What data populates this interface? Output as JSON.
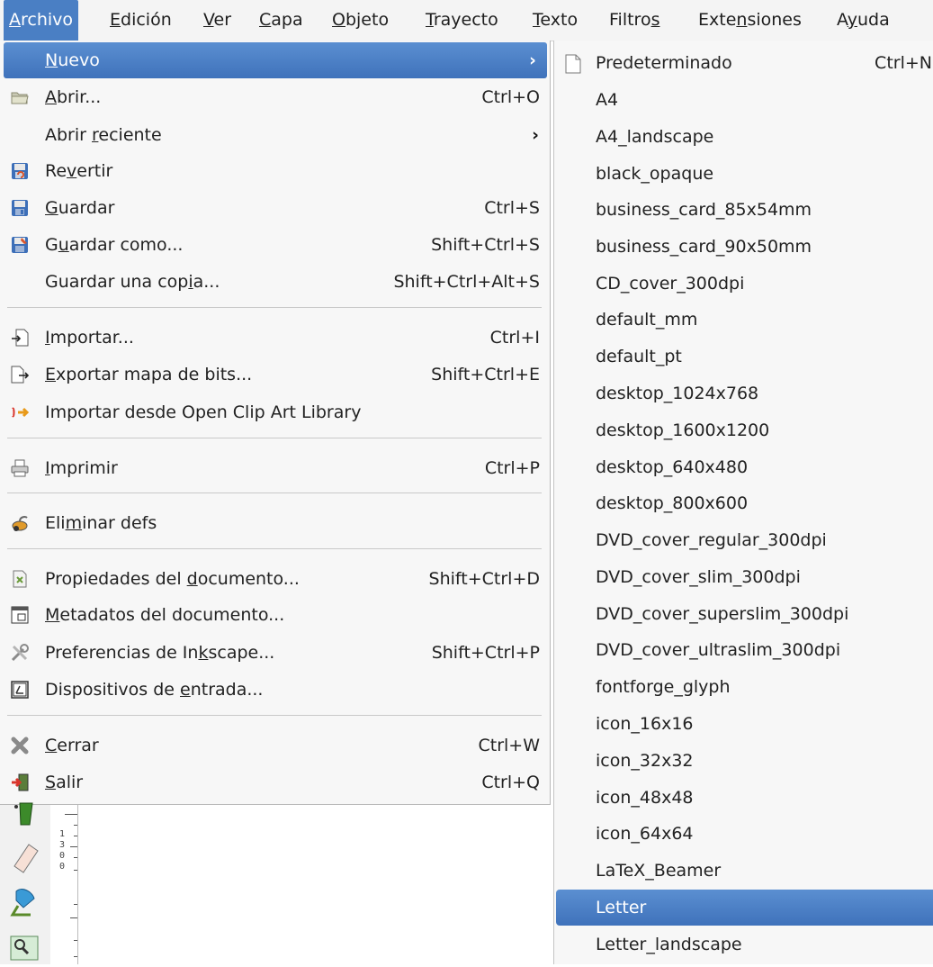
{
  "menubar": {
    "items": [
      {
        "pre": "",
        "u": "A",
        "post": "rchivo",
        "active": true
      },
      {
        "pre": "",
        "u": "E",
        "post": "dición"
      },
      {
        "pre": "",
        "u": "V",
        "post": "er"
      },
      {
        "pre": "",
        "u": "C",
        "post": "apa"
      },
      {
        "pre": "",
        "u": "O",
        "post": "bjeto"
      },
      {
        "pre": "",
        "u": "T",
        "post": "rayecto"
      },
      {
        "pre": "",
        "u": "T",
        "post": "exto"
      },
      {
        "pre": "Filtro",
        "u": "s",
        "post": ""
      },
      {
        "pre": "Exte",
        "u": "n",
        "post": "siones"
      },
      {
        "pre": "A",
        "u": "y",
        "post": "uda"
      }
    ]
  },
  "archivo_menu": {
    "nuevo": {
      "pre": "",
      "u": "N",
      "post": "uevo",
      "arrow": "›"
    },
    "abrir": {
      "pre": "",
      "u": "A",
      "post": "brir...",
      "shortcut": "Ctrl+O",
      "icon": "folder-open-icon"
    },
    "abrir_reciente": {
      "pre": "Abrir ",
      "u": "r",
      "post": "eciente",
      "arrow": "›"
    },
    "revertir": {
      "pre": "Re",
      "u": "v",
      "post": "ertir",
      "icon": "revert-icon"
    },
    "guardar": {
      "pre": "",
      "u": "G",
      "post": "uardar",
      "shortcut": "Ctrl+S",
      "icon": "save-icon"
    },
    "guardar_como": {
      "pre": "G",
      "u": "u",
      "post": "ardar como...",
      "shortcut": "Shift+Ctrl+S",
      "icon": "save-as-icon"
    },
    "guardar_copia": {
      "pre": "Guardar una cop",
      "u": "i",
      "post": "a...",
      "shortcut": "Shift+Ctrl+Alt+S"
    },
    "importar": {
      "pre": "",
      "u": "I",
      "post": "mportar...",
      "shortcut": "Ctrl+I",
      "icon": "import-icon"
    },
    "exportar": {
      "pre": "",
      "u": "E",
      "post": "xportar mapa de bits...",
      "shortcut": "Shift+Ctrl+E",
      "icon": "export-icon"
    },
    "importar_ocal": {
      "pre": "Importar desde Open Clip Art Library",
      "u": "",
      "post": "",
      "icon": "open-clip-art-icon"
    },
    "imprimir": {
      "pre": "",
      "u": "I",
      "post": "mprimir",
      "shortcut": "Ctrl+P",
      "icon": "print-icon"
    },
    "eliminar_defs": {
      "pre": "Eli",
      "u": "m",
      "post": "inar defs",
      "icon": "vacuum-defs-icon"
    },
    "propiedades": {
      "pre": "Propiedades del ",
      "u": "d",
      "post": "ocumento...",
      "shortcut": "Shift+Ctrl+D",
      "icon": "document-properties-icon"
    },
    "metadatos": {
      "pre": "",
      "u": "M",
      "post": "etadatos del documento...",
      "icon": "metadata-icon"
    },
    "preferencias": {
      "pre": "Preferencias de In",
      "u": "k",
      "post": "scape...",
      "shortcut": "Shift+Ctrl+P",
      "icon": "preferences-icon"
    },
    "dispositivos": {
      "pre": "Dispositivos de ",
      "u": "e",
      "post": "ntrada...",
      "icon": "input-devices-icon"
    },
    "cerrar": {
      "pre": "",
      "u": "C",
      "post": "errar",
      "shortcut": "Ctrl+W",
      "icon": "close-icon"
    },
    "salir": {
      "pre": "",
      "u": "S",
      "post": "alir",
      "shortcut": "Ctrl+Q",
      "icon": "quit-icon"
    }
  },
  "nuevo_submenu": {
    "items": [
      {
        "label": "Predeterminado",
        "shortcut": "Ctrl+N",
        "icon": "new-document-icon"
      },
      {
        "label": "A4"
      },
      {
        "label": "A4_landscape"
      },
      {
        "label": "black_opaque"
      },
      {
        "label": "business_card_85x54mm"
      },
      {
        "label": "business_card_90x50mm"
      },
      {
        "label": "CD_cover_300dpi"
      },
      {
        "label": "default_mm"
      },
      {
        "label": "default_pt"
      },
      {
        "label": "desktop_1024x768"
      },
      {
        "label": "desktop_1600x1200"
      },
      {
        "label": "desktop_640x480"
      },
      {
        "label": "desktop_800x600"
      },
      {
        "label": "DVD_cover_regular_300dpi"
      },
      {
        "label": "DVD_cover_slim_300dpi"
      },
      {
        "label": "DVD_cover_superslim_300dpi"
      },
      {
        "label": "DVD_cover_ultraslim_300dpi"
      },
      {
        "label": "fontforge_glyph"
      },
      {
        "label": "icon_16x16"
      },
      {
        "label": "icon_32x32"
      },
      {
        "label": "icon_48x48"
      },
      {
        "label": "icon_64x64"
      },
      {
        "label": "LaTeX_Beamer"
      },
      {
        "label": "Letter",
        "highlighted": true
      },
      {
        "label": "Letter_landscape"
      }
    ]
  },
  "ruler": {
    "digits": [
      "1",
      "3",
      "0",
      "0"
    ]
  },
  "colors": {
    "highlight": "#4a7fc4",
    "menu_bg": "#f7f7f7",
    "menubar_bg": "#f4f4f4"
  }
}
